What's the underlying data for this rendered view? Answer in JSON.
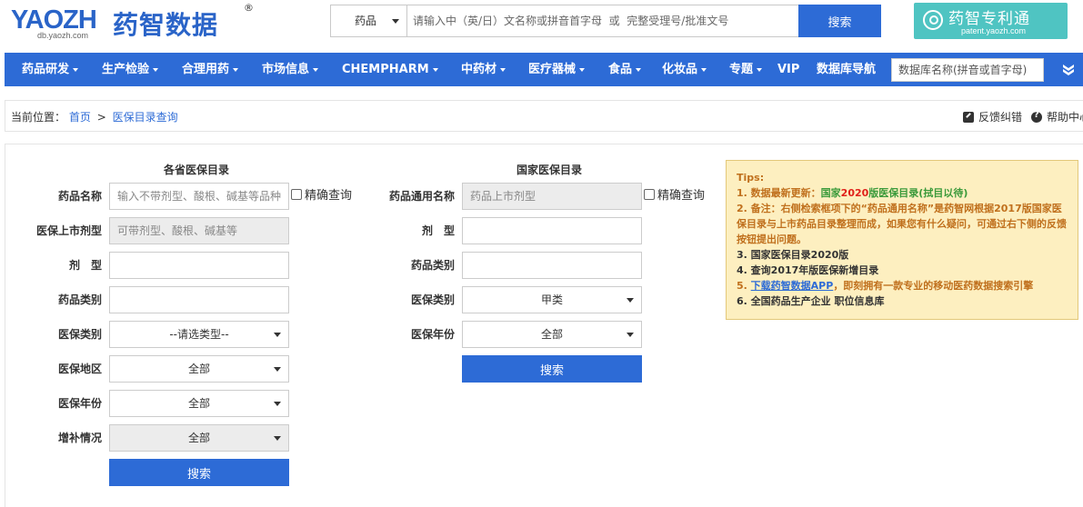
{
  "header": {
    "logo_en": "YAOZH",
    "logo_sub": "db.yaozh.com",
    "logo_cn": "药智数据",
    "logo_reg": "®",
    "search_type": "药品",
    "search_placeholder": "请输入中（英/日）文名称或拼音首字母  或  完整受理号/批准文号",
    "search_button": "搜索",
    "patent_cn": "药智专利通",
    "patent_en": "patent.yaozh.com"
  },
  "nav": {
    "items": [
      {
        "label": "药品研发"
      },
      {
        "label": "生产检验"
      },
      {
        "label": "合理用药"
      },
      {
        "label": "市场信息"
      },
      {
        "label": "CHEMPHARM"
      },
      {
        "label": "中药材"
      },
      {
        "label": "医疗器械"
      },
      {
        "label": "食品"
      },
      {
        "label": "化妆品"
      },
      {
        "label": "专题"
      },
      {
        "label": "VIP"
      },
      {
        "label": "数据库导航"
      }
    ],
    "search_placeholder": "数据库名称(拼音或首字母)"
  },
  "breadcrumb": {
    "prefix": "当前位置：",
    "home": "首页",
    "separator": ">",
    "current": "医保目录查询",
    "feedback": "反馈纠错",
    "help": "帮助中心"
  },
  "provincial": {
    "title": "各省医保目录",
    "name_label": "药品名称",
    "name_placeholder": "输入不带剂型、酸根、碱基等品种",
    "exact_label": "精确查询",
    "form_name_label": "医保上市剂型",
    "form_name_placeholder": "可带剂型、酸根、碱基等",
    "dosage_label": "剂　型",
    "category_label": "药品类别",
    "insurance_type_label": "医保类别",
    "insurance_type_value": "--请选类型--",
    "region_label": "医保地区",
    "region_value": "全部",
    "year_label": "医保年份",
    "year_value": "全部",
    "supplement_label": "增补情况",
    "supplement_value": "全部",
    "search_button": "搜索"
  },
  "national": {
    "title": "国家医保目录",
    "generic_label": "药品通用名称",
    "generic_placeholder": "药品上市剂型",
    "exact_label": "精确查询",
    "dosage_label": "剂　型",
    "category_label": "药品类别",
    "insurance_type_label": "医保类别",
    "insurance_type_value": "甲类",
    "year_label": "医保年份",
    "year_value": "全部",
    "search_button": "搜索"
  },
  "tips": {
    "title": "Tips:",
    "line1_prefix": "1. 数据最新更新：",
    "line1_green_a": "国家",
    "line1_red": "2020",
    "line1_green_b": "版医保目录(拭目以待)",
    "line2": "2. 备注：右侧检索框项下的“药品通用名称”是药智网根据2017版国家医保目录与上市药品目录整理而成，如果您有什么疑问，可通过右下侧的反馈按钮提出问题。",
    "line3": "3. 国家医保目录2020版",
    "line4": "4. 查询2017年版医保新增目录",
    "line5_link": "下载药智数据APP",
    "line5_rest": "，即刻拥有一款专业的移动医药数据搜索引擎",
    "line5_prefix": "5. ",
    "line6": "6. 全国药品生产企业 职位信息库"
  },
  "colors": {
    "primary": "#2d6bd6",
    "tips_bg": "#fdefc0",
    "tips_text": "#c0701d",
    "patent_bg": "#4fc4c2"
  }
}
